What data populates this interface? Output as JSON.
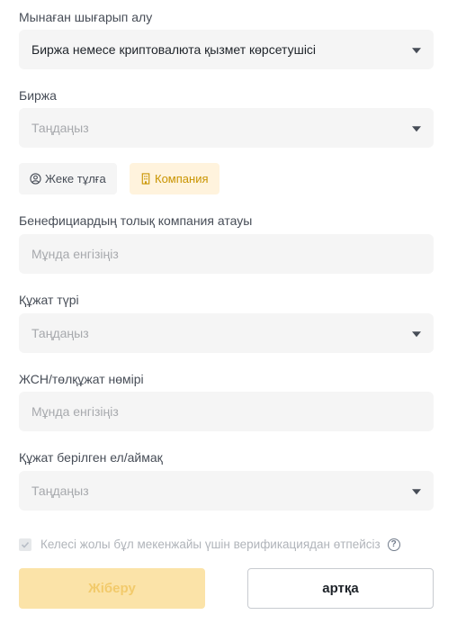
{
  "withdraw_to": {
    "label": "Мынаған шығарып алу",
    "value": "Биржа немесе криптовалюта қызмет көрсетушісі"
  },
  "exchange": {
    "label": "Биржа",
    "placeholder": "Таңдаңыз"
  },
  "entity_toggle": {
    "individual": "Жеке тұлға",
    "company": "Компания",
    "selected": "company"
  },
  "beneficiary_name": {
    "label": "Бенефициардың толық компания атауы",
    "placeholder": "Мұнда енгізіңіз"
  },
  "document_type": {
    "label": "Құжат түрі",
    "placeholder": "Таңдаңыз"
  },
  "document_number": {
    "label": "ЖСН/төлқұжат нөмірі",
    "placeholder": "Мұнда енгізіңіз"
  },
  "issuing_country": {
    "label": "Құжат берілген ел/аймақ",
    "placeholder": "Таңдаңыз"
  },
  "skip_verification": {
    "label": "Келесі жолы бұл мекенжайы үшін верификациядан өтпейсіз",
    "checked": true
  },
  "buttons": {
    "submit": "Жіберу",
    "back": "артқа"
  },
  "colors": {
    "accent": "#c99400",
    "accent_bg": "#fff3dd",
    "submit_disabled_bg": "#fbe3a8",
    "field_bg": "#f5f5f5"
  }
}
